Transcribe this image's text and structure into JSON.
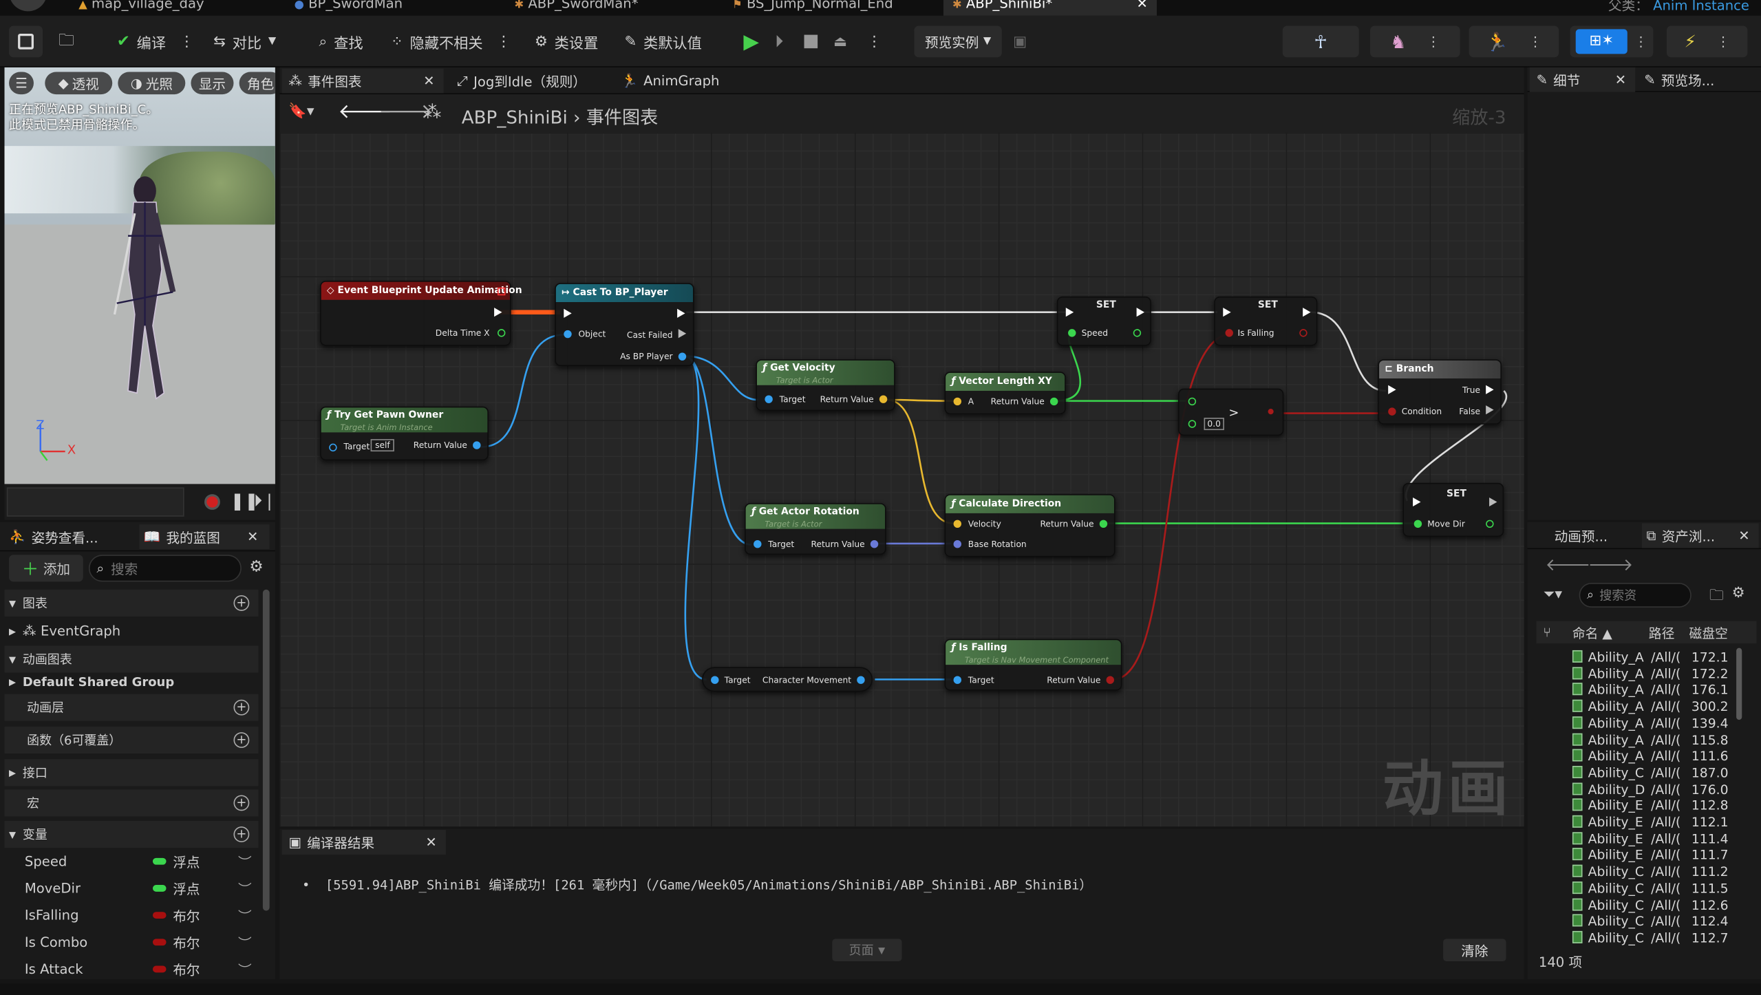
{
  "tabs": [
    {
      "label": "map_village_day"
    },
    {
      "label": "BP_SwordMan"
    },
    {
      "label": "ABP_SwordMan*"
    },
    {
      "label": "BS_Jump_Normal_End"
    },
    {
      "label": "ABP_ShiniBi*"
    }
  ],
  "parent_class": {
    "label": "父类：",
    "value": "Anim Instance"
  },
  "toolbar": {
    "compile": "编译",
    "diff": "对比",
    "find": "查找",
    "hide_unrelated": "隐藏不相关",
    "class_settings": "类设置",
    "class_defaults": "类默认值",
    "preview_instance": "预览实例"
  },
  "viewport": {
    "btn_perspective": "透视",
    "btn_lit": "光照",
    "btn_show": "显示",
    "btn_character": "角色",
    "message_line1": "正在预览ABP_ShiniBi_C。",
    "message_line2": "此模式已禁用骨骼操作。",
    "axis_z": "Z",
    "axis_x": "X"
  },
  "left_tabs": {
    "pose_watch": "姿势查看...",
    "my_blueprint": "我的蓝图"
  },
  "my_blueprint": {
    "add": "添加",
    "search_placeholder": "搜索",
    "graphs": "图表",
    "event_graph": "EventGraph",
    "anim_graphs": "动画图表",
    "default_shared_group": "Default Shared Group",
    "anim_layers": "动画层",
    "functions": "函数（6可覆盖）",
    "interfaces": "接口",
    "macros": "宏",
    "variables": "变量",
    "vars": [
      {
        "name": "Speed",
        "type": "浮点",
        "color": "#3bd64e"
      },
      {
        "name": "MoveDir",
        "type": "浮点",
        "color": "#3bd64e"
      },
      {
        "name": "IsFalling",
        "type": "布尔",
        "color": "#a80f0f"
      },
      {
        "name": "Is Combo",
        "type": "布尔",
        "color": "#a80f0f"
      },
      {
        "name": "Is Attack",
        "type": "布尔",
        "color": "#a80f0f"
      }
    ]
  },
  "graph_tabs": {
    "event_graph": "事件图表",
    "jog_to_idle": "Jog到Idle（规则）",
    "anim_graph": "AnimGraph"
  },
  "breadcrumb": {
    "bp": "ABP_ShiniBi",
    "graph": "事件图表",
    "zoom": "缩放-3"
  },
  "watermark": "动画",
  "nodes": {
    "event": {
      "title": "Event Blueprint Update Animation",
      "pin": "Delta Time X"
    },
    "cast": {
      "title": "Cast To BP_Player",
      "object": "Object",
      "failed": "Cast Failed",
      "as": "As BP Player"
    },
    "pawn": {
      "title": "Try Get Pawn Owner",
      "sub": "Target is Anim Instance",
      "target": "Target",
      "self": "self",
      "ret": "Return Value"
    },
    "vel": {
      "title": "Get Velocity",
      "sub": "Target is Actor",
      "target": "Target",
      "ret": "Return Value"
    },
    "vlen": {
      "title": "Vector Length XY",
      "a": "A",
      "ret": "Return Value"
    },
    "set1": {
      "title": "SET",
      "pin": "Speed"
    },
    "set2": {
      "title": "SET",
      "pin": "Is Falling"
    },
    "gt": {
      "op": ">",
      "val": "0.0"
    },
    "branch": {
      "title": "Branch",
      "cond": "Condition",
      "t": "True",
      "f": "False"
    },
    "rot": {
      "title": "Get Actor Rotation",
      "sub": "Target is Actor",
      "target": "Target",
      "ret": "Return Value"
    },
    "calc": {
      "title": "Calculate Direction",
      "vel": "Velocity",
      "base": "Base Rotation",
      "ret": "Return Value"
    },
    "set3": {
      "title": "SET",
      "pin": "Move Dir"
    },
    "cm": {
      "target": "Target",
      "ret": "Character Movement"
    },
    "fall": {
      "title": "Is Falling",
      "sub": "Target is Nav Movement Component",
      "target": "Target",
      "ret": "Return Value"
    }
  },
  "compiler": {
    "tab": "编译器结果",
    "message": "[5591.94]ABP_ShiniBi 编译成功！[261 毫秒内]（/Game/Week05/Animations/ShiniBi/ABP_ShiniBi.ABP_ShiniBi）",
    "page": "页面",
    "clear": "清除"
  },
  "details_tabs": {
    "details": "细节",
    "preview": "预览场..."
  },
  "content_tabs": {
    "anim": "动画预...",
    "assets": "资产浏..."
  },
  "content": {
    "search_placeholder": "搜索资",
    "col_name": "命名",
    "col_path": "路径",
    "col_disk": "磁盘空",
    "rows": [
      {
        "name": "Ability_A",
        "path": "/All/(",
        "size": "172.1"
      },
      {
        "name": "Ability_A",
        "path": "/All/(",
        "size": "172.2"
      },
      {
        "name": "Ability_A",
        "path": "/All/(",
        "size": "176.1"
      },
      {
        "name": "Ability_A",
        "path": "/All/(",
        "size": "300.2"
      },
      {
        "name": "Ability_A",
        "path": "/All/(",
        "size": "139.4"
      },
      {
        "name": "Ability_A",
        "path": "/All/(",
        "size": "115.8"
      },
      {
        "name": "Ability_A",
        "path": "/All/(",
        "size": "111.6"
      },
      {
        "name": "Ability_C",
        "path": "/All/(",
        "size": "187.0"
      },
      {
        "name": "Ability_D",
        "path": "/All/(",
        "size": "176.0"
      },
      {
        "name": "Ability_E",
        "path": "/All/(",
        "size": "112.8"
      },
      {
        "name": "Ability_E",
        "path": "/All/(",
        "size": "112.1"
      },
      {
        "name": "Ability_E",
        "path": "/All/(",
        "size": "111.4"
      },
      {
        "name": "Ability_E",
        "path": "/All/(",
        "size": "111.7"
      },
      {
        "name": "Ability_C",
        "path": "/All/(",
        "size": "111.2"
      },
      {
        "name": "Ability_C",
        "path": "/All/(",
        "size": "111.5"
      },
      {
        "name": "Ability_C",
        "path": "/All/(",
        "size": "112.6"
      },
      {
        "name": "Ability_C",
        "path": "/All/(",
        "size": "112.4"
      },
      {
        "name": "Ability_C",
        "path": "/All/(",
        "size": "112.7"
      }
    ],
    "count": "140 项"
  }
}
